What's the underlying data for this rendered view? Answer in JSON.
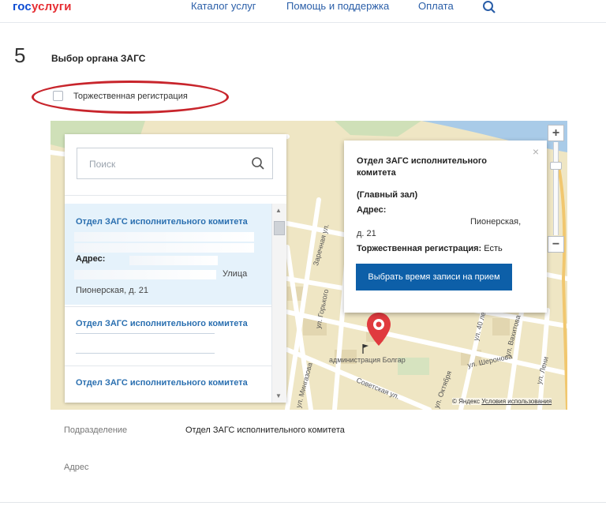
{
  "header": {
    "logo_part1": "гос",
    "logo_part2": "услуги",
    "nav": [
      "Каталог услуг",
      "Помощь и поддержка",
      "Оплата"
    ],
    "search_icon": "search-icon"
  },
  "step": {
    "number": "5",
    "title": "Выбор органа ЗАГС"
  },
  "solemn_checkbox": {
    "label": "Торжественная регистрация",
    "checked": false
  },
  "panel": {
    "search_placeholder": "Поиск",
    "items": [
      {
        "title": "Отдел ЗАГС исполнительного комитета",
        "address_label": "Адрес:",
        "street": "Улица",
        "house": "Пионерская, д. 21",
        "selected": true
      },
      {
        "title": "Отдел ЗАГС исполнительного комитета"
      },
      {
        "title": "Отдел ЗАГС исполнительного комитета"
      }
    ]
  },
  "popup": {
    "title": "Отдел ЗАГС исполнительного комитета",
    "hall": "(Главный зал)",
    "address_label": "Адрес:",
    "street": "Пионерская,",
    "house": "д. 21",
    "solemn_label": "Торжественная регистрация:",
    "solemn_value": "Есть",
    "button": "Выбрать время записи на прием",
    "close": "×"
  },
  "map": {
    "zoom_in": "+",
    "zoom_out": "−",
    "labels": {
      "admin": "администрация Болгар",
      "zarechnaya": "Заречная ул.",
      "gorkogo": "ул. Горького",
      "40let": "ул. 40 лет",
      "vakhitova": "ул. Вахитова",
      "sheronova": "ул. Шеронова",
      "mingazova": "ул. Мингазова",
      "sovetskaya": "Советская ул.",
      "oktyabrya": "ул. Октября",
      "lenina": "ул. Лени"
    },
    "copyright_brand": "© Яндекс",
    "copyright_link": "Условия использования",
    "colors": {
      "roads": "#ffffff",
      "land": "#efe6c4",
      "water": "#a9cbe8",
      "marker": "#e03a3e"
    }
  },
  "details": {
    "subdivision_label": "Подразделение",
    "subdivision_value": "Отдел ЗАГС исполнительного комитета",
    "address_label": "Адрес"
  }
}
